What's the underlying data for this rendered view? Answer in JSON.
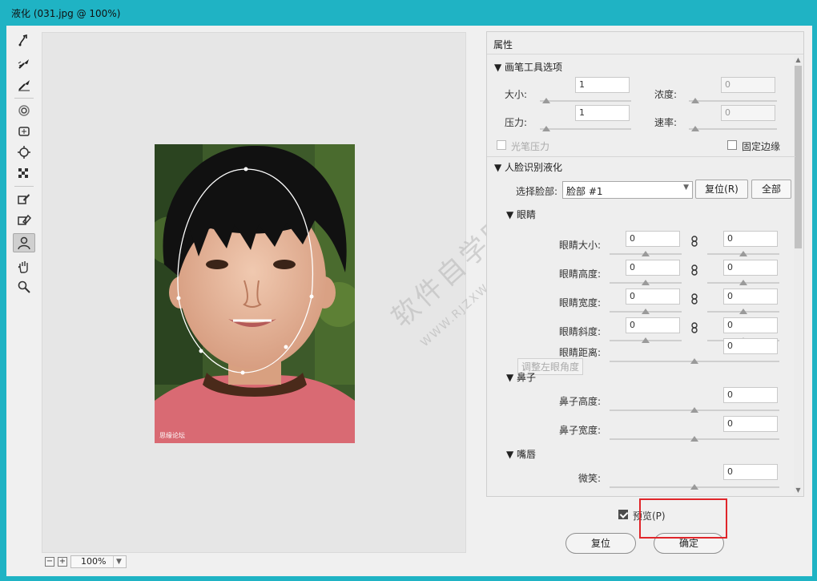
{
  "window": {
    "title": "液化 (031.jpg @ 100%)"
  },
  "colors": {
    "titlebar": "#1fb3c4",
    "highlight": "#e0262b"
  },
  "toolbar": {
    "tools": [
      {
        "name": "forward-warp-icon"
      },
      {
        "name": "reconstruct-icon"
      },
      {
        "name": "smooth-icon"
      },
      {
        "name": "twirl-clockwise-icon"
      },
      {
        "name": "pucker-icon"
      },
      {
        "name": "bloat-icon"
      },
      {
        "name": "push-left-icon"
      },
      {
        "name": "freeze-mask-icon"
      },
      {
        "name": "thaw-mask-icon"
      },
      {
        "name": "face-tool-icon",
        "selected": true
      },
      {
        "name": "hand-icon"
      },
      {
        "name": "zoom-icon"
      }
    ]
  },
  "canvas": {
    "photo_credit": "思缘论坛",
    "watermark": "软件自学网",
    "watermark_sub": "WWW.RJZXW.COM",
    "zoom": {
      "minus": "−",
      "plus": "+",
      "level": "100%"
    }
  },
  "panel": {
    "title": "属性",
    "brush": {
      "header": "画笔工具选项",
      "size_label": "大小:",
      "size": "1",
      "density_label": "浓度:",
      "density": "0",
      "pressure_label": "压力:",
      "pressure": "1",
      "rate_label": "速率:",
      "rate": "0",
      "stylus_label": "光笔压力",
      "pin_edges_label": "固定边缘"
    },
    "face": {
      "header": "人脸识别液化",
      "select_label": "选择脸部:",
      "select_value": "脸部 #1",
      "reset": "复位(R)",
      "all": "全部",
      "eyes": {
        "header": "眼睛",
        "rows": [
          {
            "label": "眼睛大小:",
            "left": "0",
            "right": "0"
          },
          {
            "label": "眼睛高度:",
            "left": "0",
            "right": "0"
          },
          {
            "label": "眼睛宽度:",
            "left": "0",
            "right": "0"
          },
          {
            "label": "眼睛斜度:",
            "left": "0",
            "right": "0"
          }
        ],
        "distance_label": "眼睛距离:",
        "distance": "0",
        "tooltip": "调整左眼角度"
      },
      "nose": {
        "header": "鼻子",
        "height_label": "鼻子高度:",
        "height": "0",
        "width_label": "鼻子宽度:",
        "width": "0"
      },
      "mouth": {
        "header": "嘴唇",
        "smile_label": "微笑:",
        "smile": "0"
      }
    }
  },
  "footer": {
    "preview_label": "预览(P)",
    "preview_checked": true,
    "reset": "复位",
    "ok": "确定"
  }
}
